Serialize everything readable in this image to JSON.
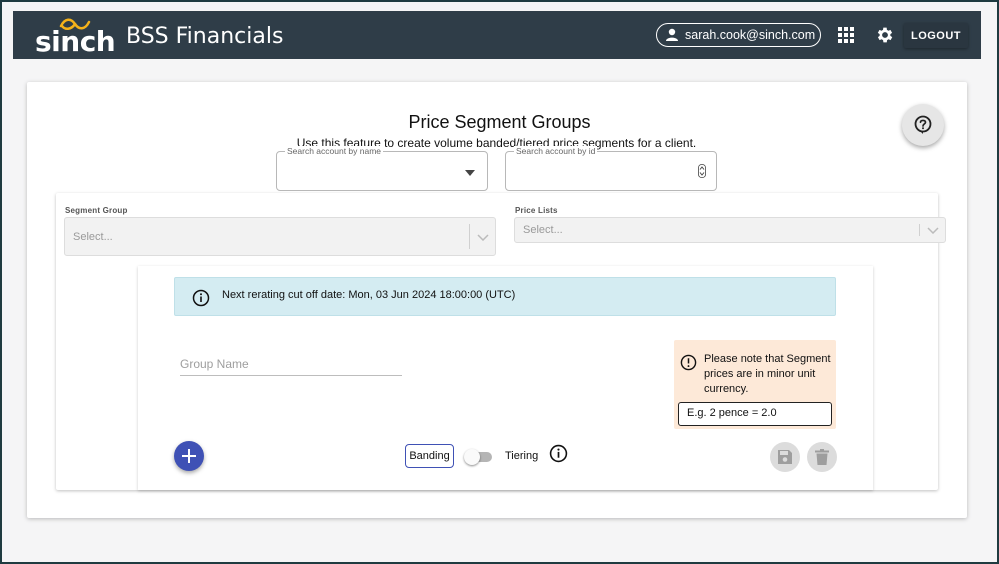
{
  "appbar": {
    "brand": "sinch",
    "title": "BSS Financials",
    "user_email": "sarah.cook@sinch.com",
    "logout_label": "LOGOUT",
    "background": "#2f3d48"
  },
  "page": {
    "title": "Price Segment Groups",
    "subtitle": "Use this feature to create volume banded/tiered price segments for a client."
  },
  "search": {
    "account_name_label": "Search account by name",
    "account_id_label": "Search account by id"
  },
  "filters": {
    "segment_group_label": "Segment Group",
    "segment_group_placeholder": "Select...",
    "price_lists_label": "Price Lists",
    "price_lists_placeholder": "Select..."
  },
  "alert": {
    "message": "Next rerating cut off date: Mon, 03 Jun 2024 18:00:00 (UTC)",
    "color": "#d4ecf2"
  },
  "form": {
    "group_name_placeholder": "Group Name"
  },
  "note": {
    "text": "Please note that Segment prices are in minor unit currency.",
    "example": "E.g. 2 pence = 2.0",
    "color": "#fde9d8"
  },
  "mode": {
    "banding_label": "Banding",
    "tiering_label": "Tiering",
    "tiering_enabled": false
  },
  "accent": "#3f51b5"
}
